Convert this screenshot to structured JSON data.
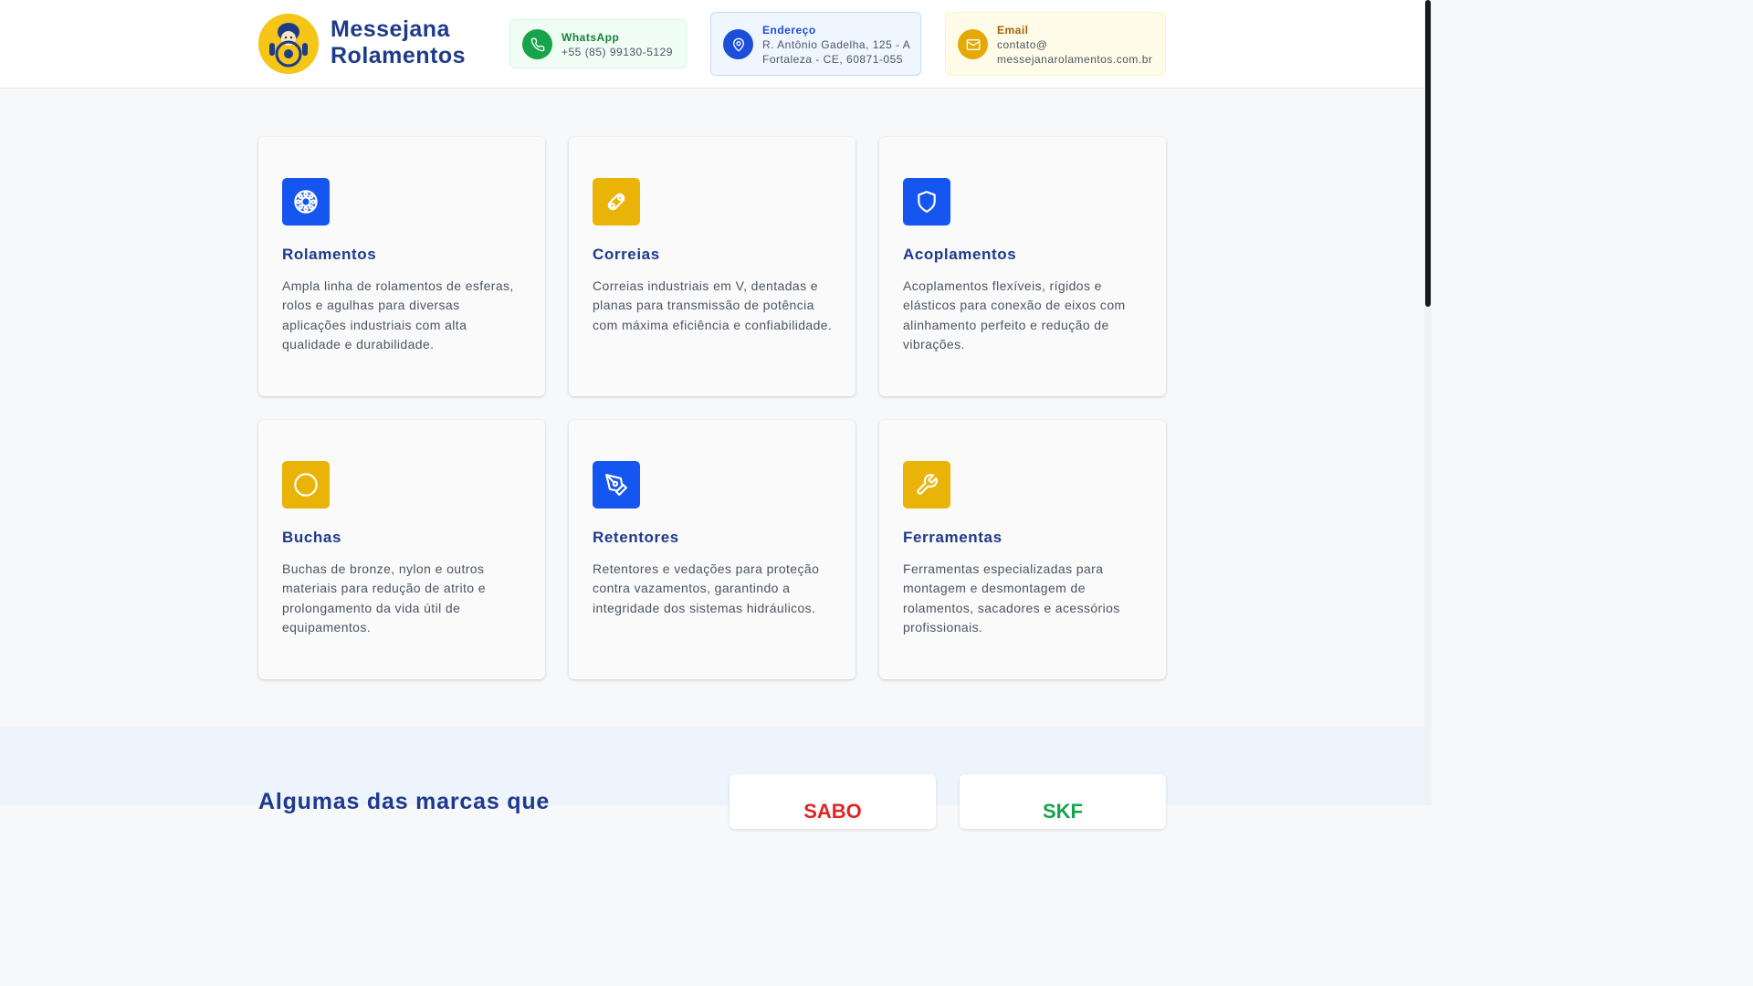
{
  "header": {
    "brand_line1": "Messejana",
    "brand_line2": "Rolamentos",
    "whatsapp": {
      "title": "WhatsApp",
      "value": "+55 (85) 99130-5129",
      "icon": "phone-icon"
    },
    "address": {
      "title": "Endereço",
      "line1": "R. Antônio Gadelha, 125 - A",
      "line2": "Fortaleza - CE, 60871-055",
      "icon": "map-pin-icon"
    },
    "email": {
      "title": "Email",
      "line1": "contato@",
      "line2": "messejanarolamentos.com.br",
      "icon": "mail-icon"
    }
  },
  "products": [
    {
      "title": "Rolamentos",
      "description": "Ampla linha de rolamentos de esferas, rolos e agulhas para diversas aplicações industriais com alta qualidade e durabilidade.",
      "icon": "bearing-icon",
      "color": "#1556f0"
    },
    {
      "title": "Correias",
      "description": "Correias industriais em V, dentadas e planas para transmissão de potência com máxima eficiência e confiabilidade.",
      "icon": "belt-icon",
      "color": "#eab308"
    },
    {
      "title": "Acoplamentos",
      "description": "Acoplamentos flexíveis, rígidos e elásticos para conexão de eixos com alinhamento perfeito e redução de vibrações.",
      "icon": "shield-icon",
      "color": "#1556f0"
    },
    {
      "title": "Buchas",
      "description": "Buchas de bronze, nylon e outros materiais para redução de atrito e prolongamento da vida útil de equipamentos.",
      "icon": "circle-icon",
      "color": "#eab308"
    },
    {
      "title": "Retentores",
      "description": "Retentores e vedações para proteção contra vazamentos, garantindo a integridade dos sistemas hidráulicos.",
      "icon": "pen-tool-icon",
      "color": "#1556f0"
    },
    {
      "title": "Ferramentas",
      "description": "Ferramentas especializadas para montagem e desmontagem de rolamentos, sacadores e acessórios profissionais.",
      "icon": "wrench-icon",
      "color": "#eab308"
    }
  ],
  "brands_section": {
    "title": "Algumas das marcas que",
    "brands": [
      {
        "name": "SABO",
        "color": "#dc2626"
      },
      {
        "name": "SKF",
        "color": "#16a34a"
      }
    ]
  },
  "colors": {
    "primary": "#1e3a8a",
    "accent_blue": "#1556f0",
    "accent_yellow": "#eab308"
  }
}
